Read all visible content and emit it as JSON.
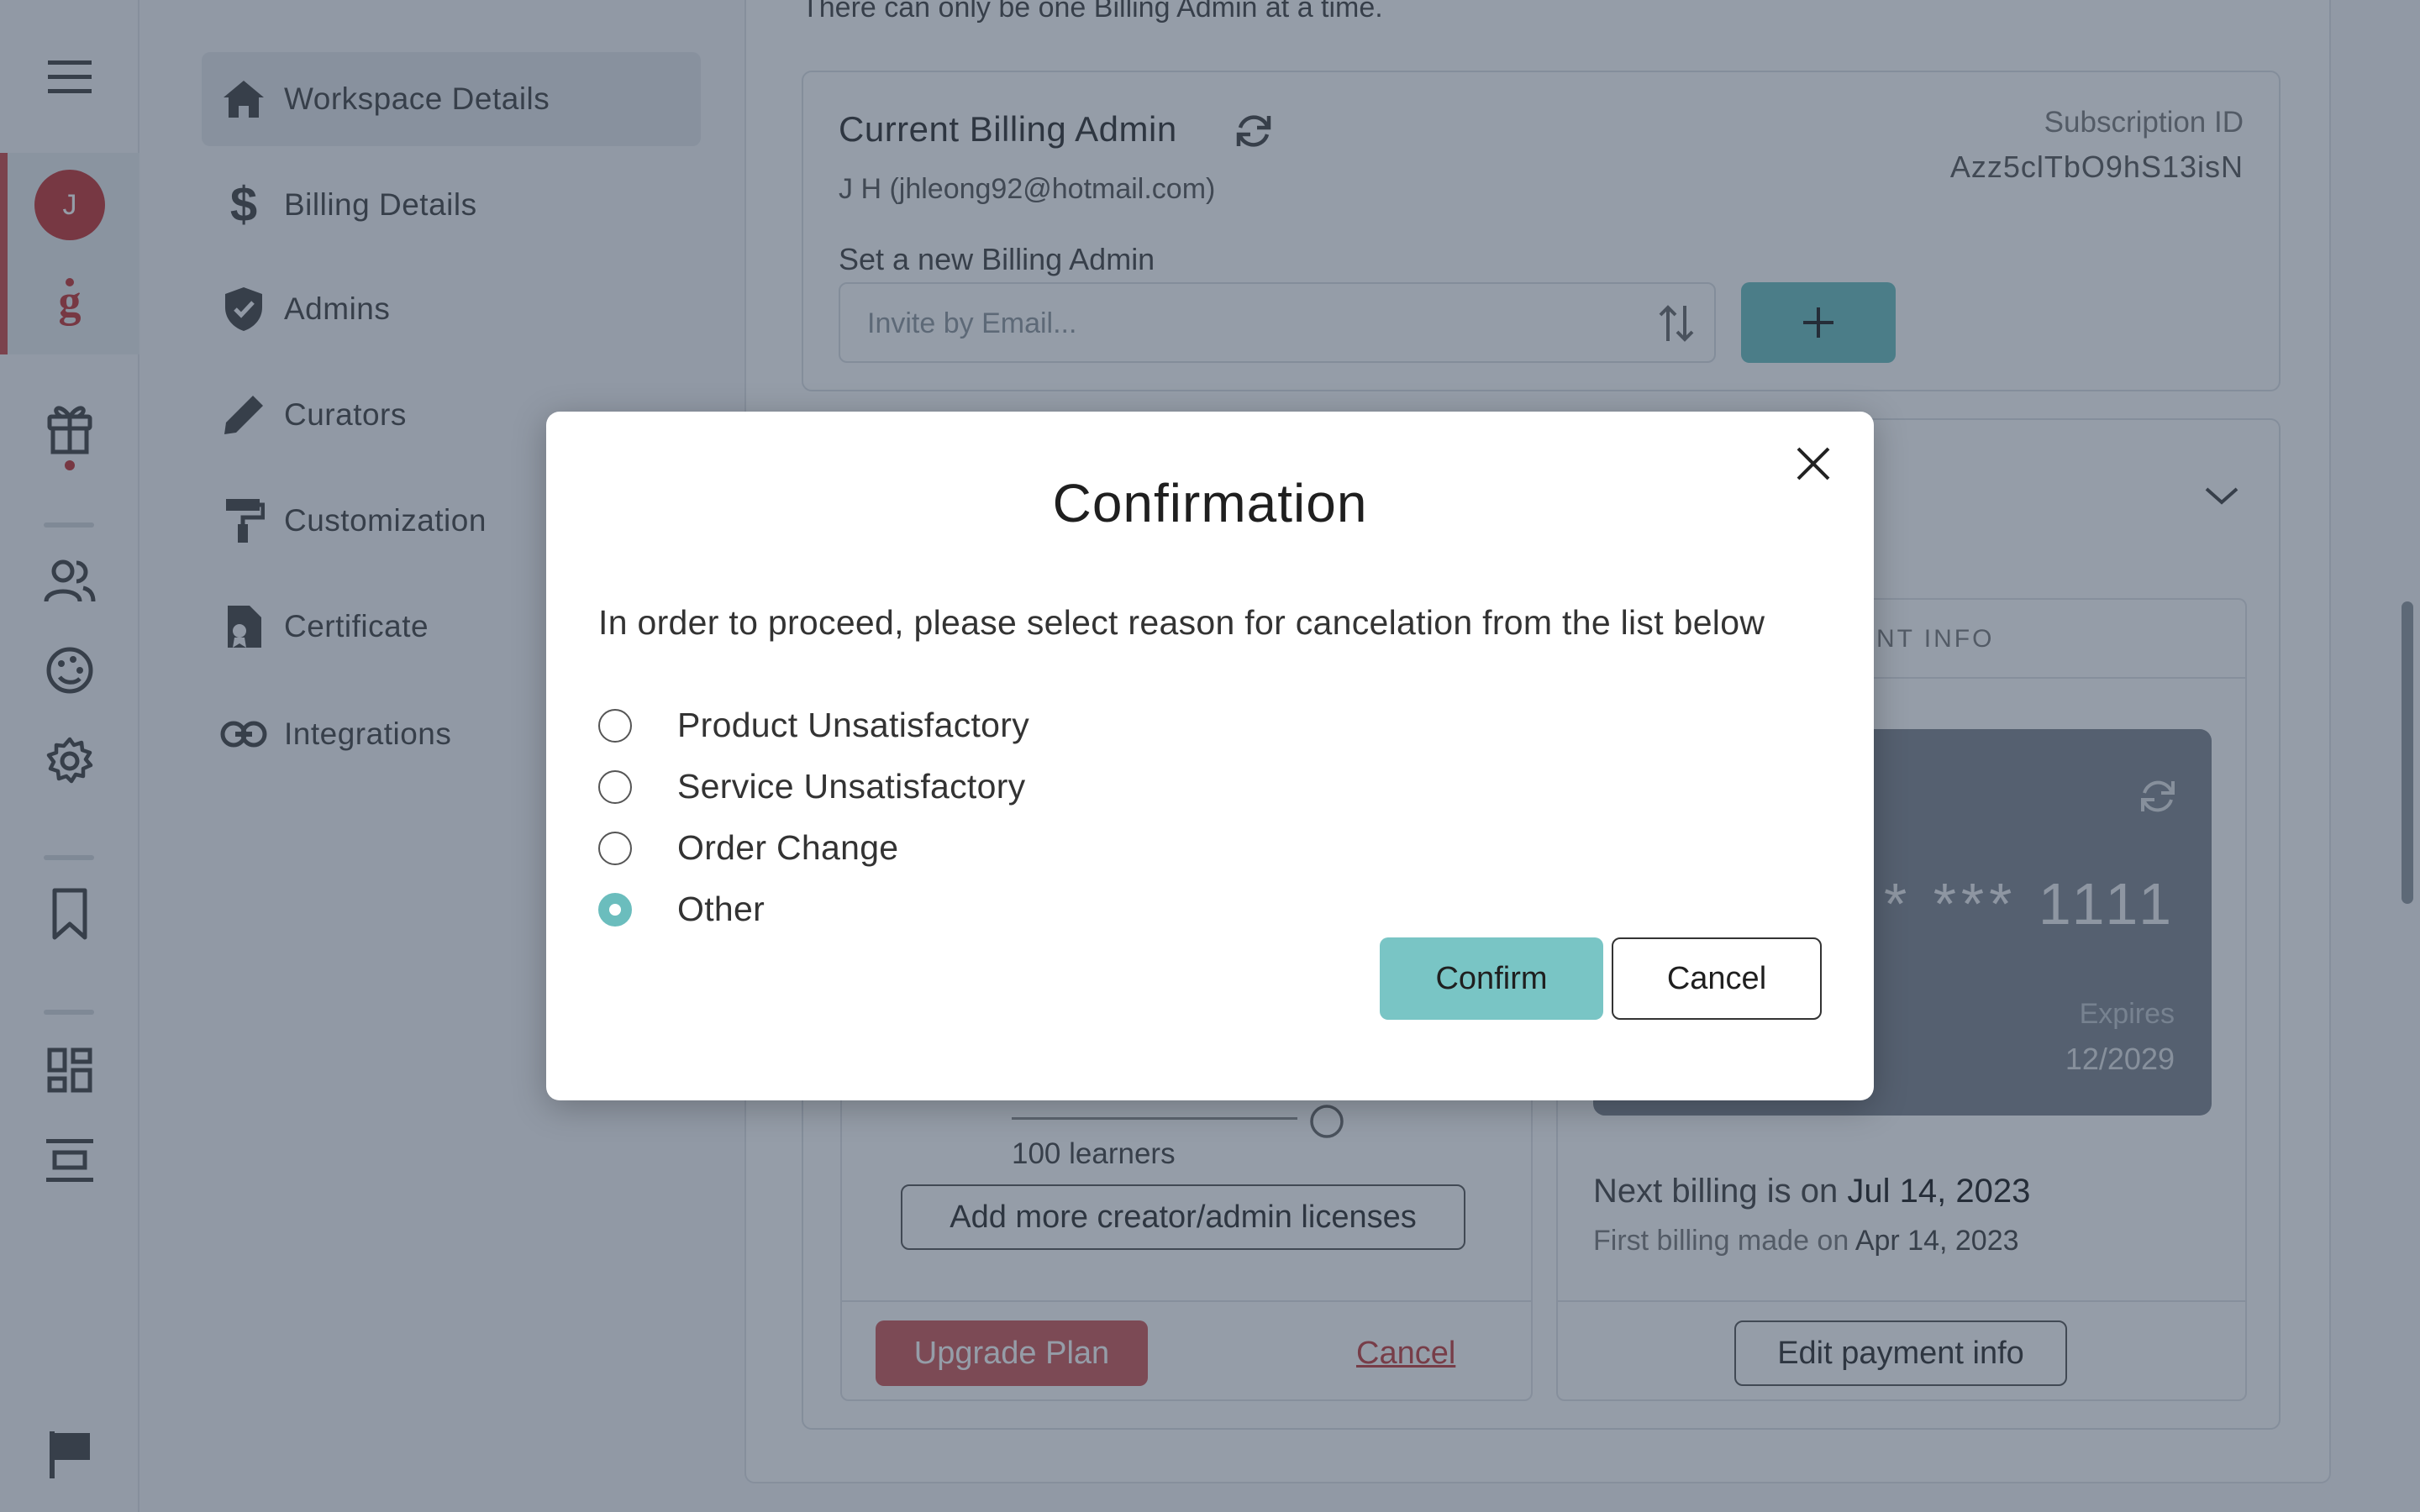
{
  "rail": {
    "avatar_initial": "J",
    "items": [
      "menu-icon",
      "avatar",
      "g-logo-icon",
      "gift-icon",
      "users-icon",
      "palette-icon",
      "settings-icon",
      "bookmark-icon",
      "dashboard-icon",
      "layout-icon",
      "flag-icon"
    ]
  },
  "nav": {
    "items": [
      {
        "label": "Workspace Details",
        "icon": "home-icon"
      },
      {
        "label": "Billing Details",
        "icon": "dollar-icon"
      },
      {
        "label": "Admins",
        "icon": "shield-icon"
      },
      {
        "label": "Curators",
        "icon": "pencil-icon"
      },
      {
        "label": "Customization",
        "icon": "paint-roller-icon"
      },
      {
        "label": "Certificate",
        "icon": "certificate-icon"
      },
      {
        "label": "Integrations",
        "icon": "link-icon"
      }
    ]
  },
  "billing_admin": {
    "note": "There can only be one Billing Admin at a time.",
    "title": "Current Billing Admin",
    "current": "J H (jhleong92@hotmail.com)",
    "subscription_label": "Subscription ID",
    "subscription_id": "Azz5clTbO9hS13isN",
    "set_new_label": "Set a new Billing Admin",
    "invite_placeholder": "Invite by Email..."
  },
  "plan": {
    "learners": "100 learners",
    "add_licenses": "Add more creator/admin licenses",
    "upgrade": "Upgrade Plan",
    "cancel": "Cancel"
  },
  "payment": {
    "header_fragment": "ENT INFO",
    "card_number": "* *** 1111",
    "expires_label": "Expires",
    "expires_value": "12/2029",
    "next_billing_prefix": "Next billing is on",
    "next_billing_date": "Jul 14, 2023",
    "first_billing_prefix": "First billing made on",
    "first_billing_date": "Apr 14, 2023",
    "edit": "Edit payment info"
  },
  "modal": {
    "title": "Confirmation",
    "text": "In order to proceed, please select reason for cancelation from the list below",
    "options": [
      {
        "label": "Product Unsatisfactory",
        "checked": false
      },
      {
        "label": "Service Unsatisfactory",
        "checked": false
      },
      {
        "label": "Order Change",
        "checked": false
      },
      {
        "label": "Other",
        "checked": true
      }
    ],
    "confirm": "Confirm",
    "cancel": "Cancel"
  },
  "colors": {
    "accent": "#79c5c5",
    "danger": "#d16868",
    "overlay": "rgba(20,38,62,0.45)"
  }
}
